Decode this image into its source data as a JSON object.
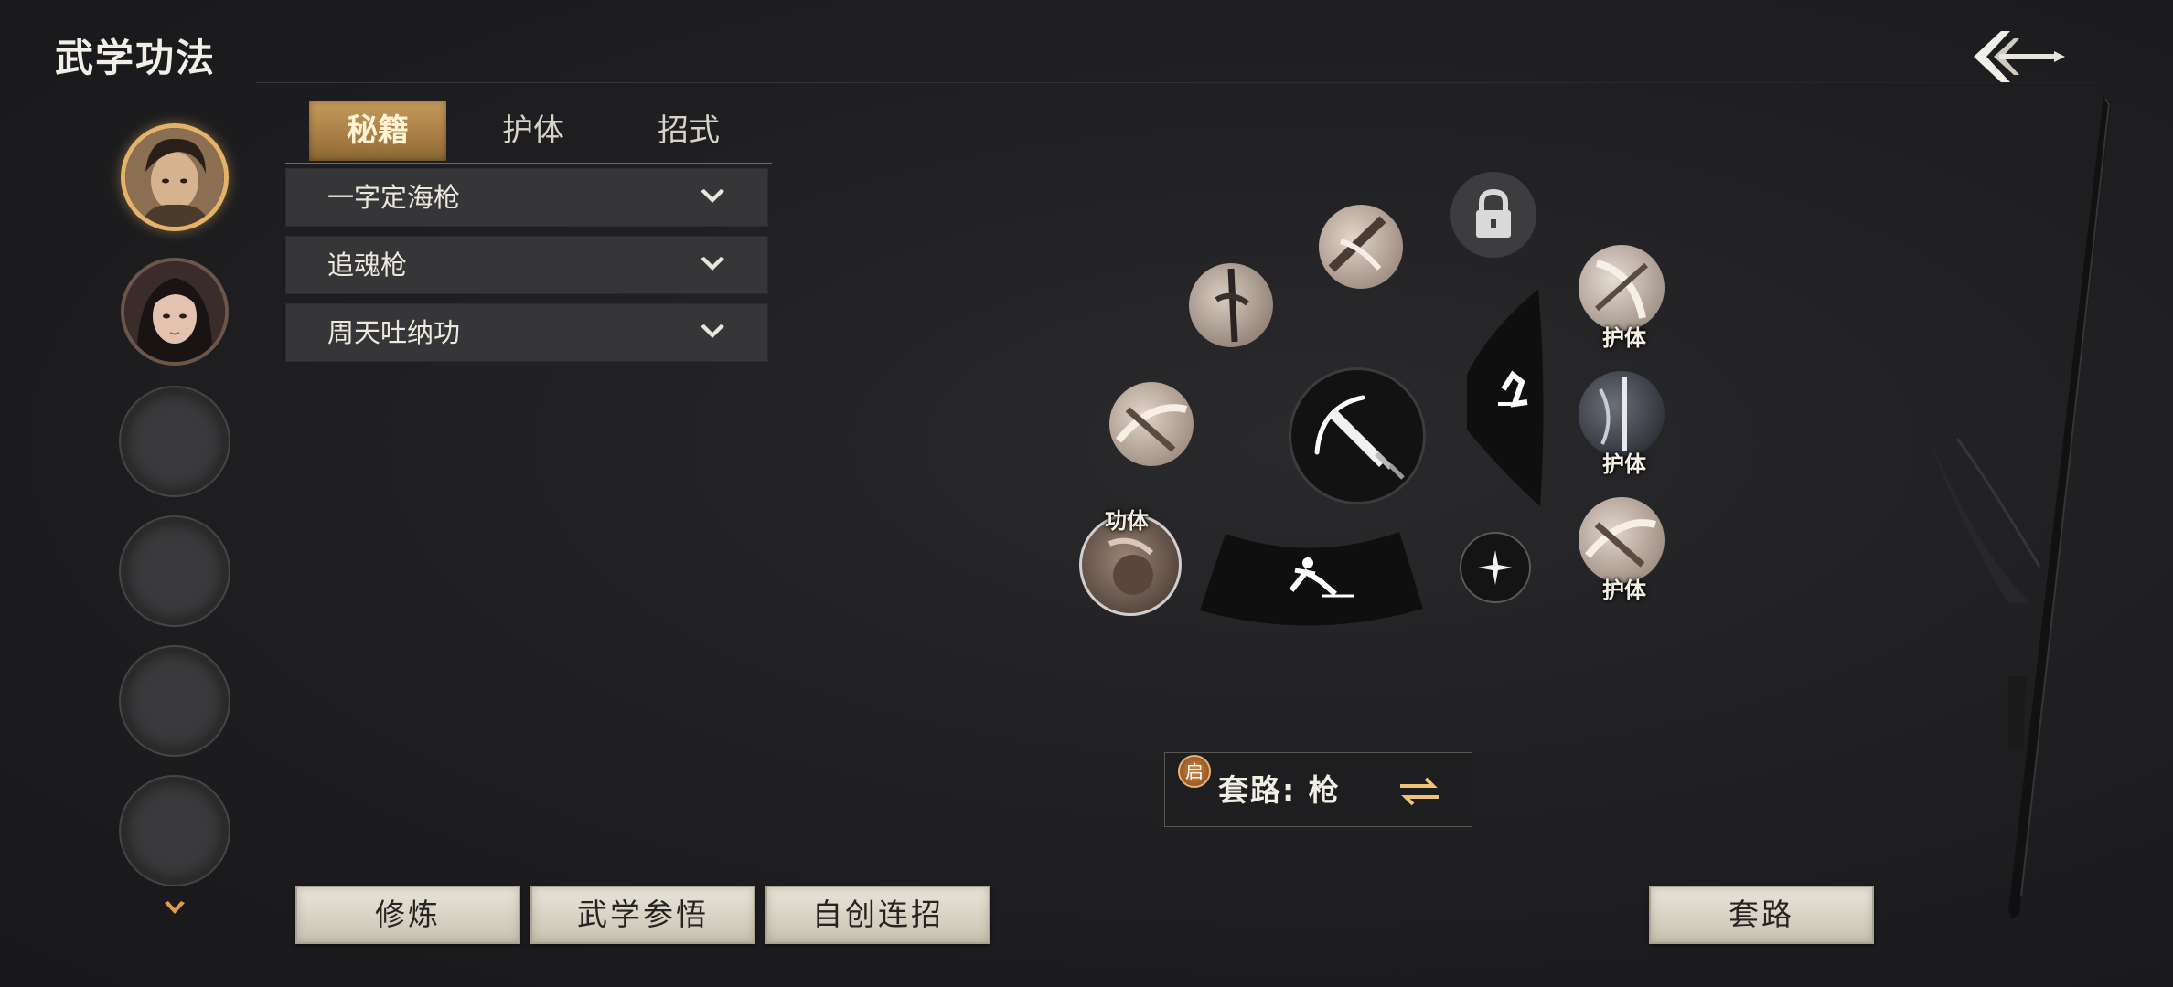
{
  "header": {
    "title": "武学功法"
  },
  "tabs": [
    {
      "label": "秘籍",
      "active": true
    },
    {
      "label": "护体",
      "active": false
    },
    {
      "label": "招式",
      "active": false
    }
  ],
  "list": [
    {
      "label": "一字定海枪"
    },
    {
      "label": "追魂枪"
    },
    {
      "label": "周天吐纳功"
    }
  ],
  "skill_wheel": {
    "labels": {
      "left_orb": "功体",
      "right_top": "护体",
      "right_mid": "护体",
      "right_bottom": "护体"
    },
    "locked_slot_icon": "lock-icon",
    "center_icon": "sword-icon"
  },
  "style_bar": {
    "badge": "启",
    "text": "套路:  枪"
  },
  "buttons": {
    "cultivate": "修炼",
    "insight": "武学参悟",
    "custom_combo": "自创连招",
    "routine": "套路"
  },
  "colors": {
    "accent": "#e4b367",
    "tab_active": "#b88a4d",
    "background": "#202022"
  }
}
